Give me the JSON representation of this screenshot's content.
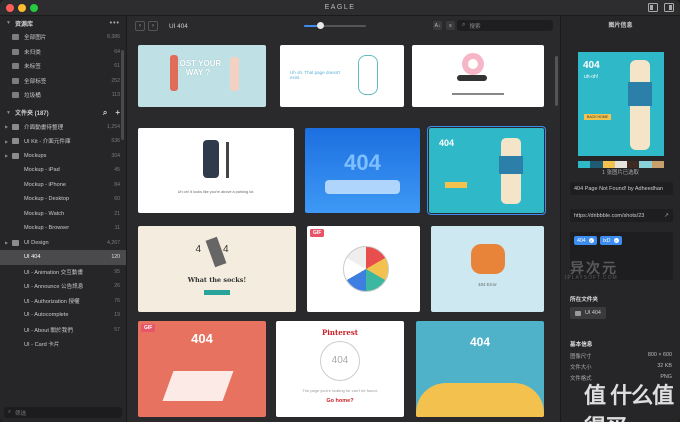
{
  "app_title": "EAGLE",
  "sidebar": {
    "library_header": "资源库",
    "library_items": [
      {
        "label": "全部图片",
        "count": "8,386"
      },
      {
        "label": "未归类",
        "count": "64"
      },
      {
        "label": "未标签",
        "count": "61"
      },
      {
        "label": "全部标签",
        "count": "252"
      },
      {
        "label": "垃圾桶",
        "count": "113"
      }
    ],
    "folders_header": "文件夹 (187)",
    "folders": [
      {
        "label": "介面動畫待整理",
        "count": "1,254",
        "sub": false
      },
      {
        "label": "UI Kit - 介面元件庫",
        "count": "536",
        "sub": false
      },
      {
        "label": "Mockups",
        "count": "304",
        "sub": false
      },
      {
        "label": "Mockup - iPad",
        "count": "45",
        "sub": true
      },
      {
        "label": "Mockup - iPhone",
        "count": "84",
        "sub": true
      },
      {
        "label": "Mockup - Desktop",
        "count": "60",
        "sub": true
      },
      {
        "label": "Mockup - Watch",
        "count": "21",
        "sub": true
      },
      {
        "label": "Mockup - Browser",
        "count": "11",
        "sub": true
      },
      {
        "label": "UI Design",
        "count": "4,267",
        "sub": false
      },
      {
        "label": "UI 404",
        "count": "120",
        "sub": true,
        "active": true
      },
      {
        "label": "UI - Animation 交互動畫",
        "count": "95",
        "sub": true
      },
      {
        "label": "UI - Announce 公告訊息",
        "count": "26",
        "sub": true
      },
      {
        "label": "UI - Authorization 授權",
        "count": "76",
        "sub": true
      },
      {
        "label": "UI - Autocomplete",
        "count": "19",
        "sub": true
      },
      {
        "label": "UI - About 關於我們",
        "count": "57",
        "sub": true
      },
      {
        "label": "UI - Card 卡片",
        "count": "",
        "sub": true
      }
    ],
    "search_placeholder": "筛选"
  },
  "toolbar": {
    "back": "‹",
    "forward": "›",
    "breadcrumb": "UI 404",
    "zoom_level": 0.25,
    "search_placeholder": "搜索"
  },
  "grid": {
    "cards": [
      {
        "text": "LOST YOUR WAY ?",
        "bg": "#bfe1e6"
      },
      {
        "text": "Uh oh. That page doesn't exist.",
        "bg": "#ffffff"
      },
      {
        "text": "",
        "bg": "#ffffff"
      },
      {
        "text": "Uh oh! It looks like you're above a parking lot.",
        "bg": "#ffffff"
      },
      {
        "text": "404",
        "bg": "#2a7fe0"
      },
      {
        "text": "404",
        "bg": "#2fb8c8"
      },
      {
        "text": "What the socks!",
        "bg": "#f3ecdf"
      },
      {
        "text": "GIF",
        "bg": "#ffffff"
      },
      {
        "text": "404 Error",
        "bg": "#cde8f0"
      },
      {
        "text": "404",
        "bg": "#e87260"
      },
      {
        "text": "The page you're looking for can't be found.",
        "bg": "#ffffff"
      },
      {
        "text": "404",
        "bg": "#4fb2c8"
      }
    ],
    "gif_badge": "GIF",
    "pinterest_text": "Pinterest",
    "go_home": "Go home?"
  },
  "inspector": {
    "title": "图片信息",
    "thumb_text": "404",
    "thumb_sub": "uh-oh!",
    "thumb_btn": "BACK HOME",
    "palette": [
      "#2fb8c8",
      "#1f5c73",
      "#f2c14e",
      "#e6e3dc",
      "#3d2a23",
      "#8ad0d8",
      "#c7a06b"
    ],
    "selection_count": "1 张图片已选取",
    "name_value": "404 Page Not Found! by Adheedhan",
    "url_value": "https://dribbble.com/shots/23",
    "tags": [
      "404",
      "ixD"
    ],
    "folder_label": "所在文件夹",
    "folder_value": "UI 404",
    "basic_label": "基本信息",
    "info": [
      {
        "k": "图像尺寸",
        "v": "800 × 600"
      },
      {
        "k": "文件大小",
        "v": "32 KB"
      },
      {
        "k": "文件格式",
        "v": "PNG"
      }
    ],
    "watermark_cn": "异次元",
    "watermark_en": "IPLAYSOFT.COM",
    "watermark_big": "值 什么值得买"
  }
}
